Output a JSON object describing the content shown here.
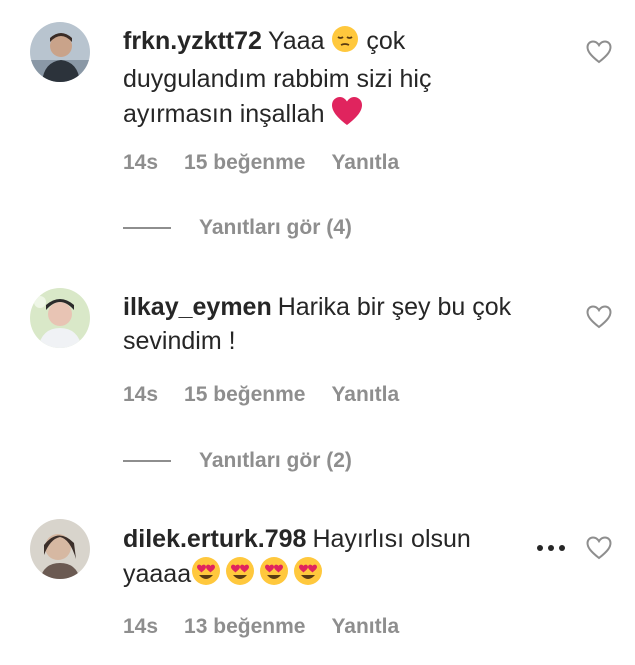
{
  "comments": [
    {
      "username": "frkn.yzktt72",
      "line1": "Yaaa",
      "line1b": "çok",
      "line2": "duygulandım rabbim sizi hiç",
      "line3": "ayırmasın inşallah",
      "emoji_1": "pensive-face-emoji",
      "emoji_2": "red-heart-emoji",
      "time": "14s",
      "likes": "15 beğenme",
      "reply": "Yanıtla",
      "view_replies": "Yanıtları gör (4)"
    },
    {
      "username": "ilkay_eymen",
      "line1": "Harika bir şey bu çok",
      "line2": "sevindim !",
      "time": "14s",
      "likes": "15 beğenme",
      "reply": "Yanıtla",
      "view_replies": "Yanıtları gör (2)"
    },
    {
      "username": "dilek.erturk.798",
      "line1": "Hayırlısı olsun",
      "line2": "yaaaa",
      "emoji": "heart-eyes-emoji",
      "time": "14s",
      "likes": "13 beğenme",
      "reply": "Yanıtla"
    }
  ],
  "colors": {
    "text": "#262626",
    "meta": "#8e8e8e",
    "heart_emoji": "#e0245e",
    "face_emoji": "#ffc83d"
  },
  "icons": [
    "like-heart-icon",
    "more-options-icon"
  ]
}
